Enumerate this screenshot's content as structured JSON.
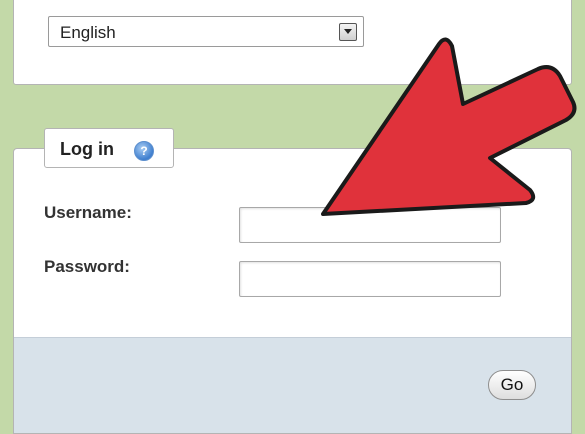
{
  "language": {
    "selected": "English"
  },
  "login": {
    "legend": "Log in",
    "help_icon_glyph": "?",
    "username_label": "Username:",
    "password_label": "Password:",
    "username_value": "",
    "password_value": "",
    "go_label": "Go"
  },
  "annotation": {
    "arrow_color": "#e0323b",
    "icon": "pointer-arrow"
  }
}
